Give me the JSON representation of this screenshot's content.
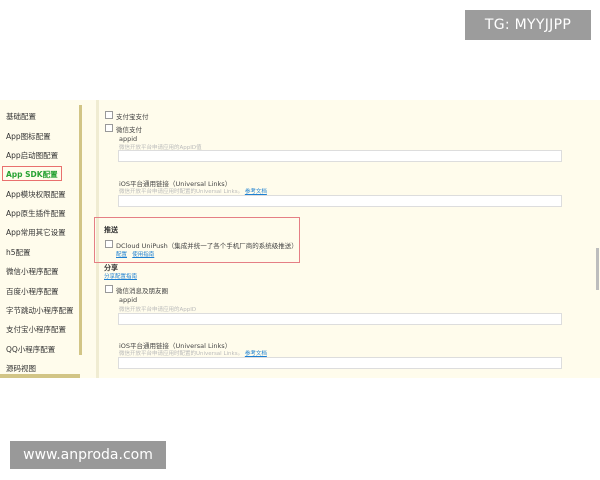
{
  "watermarks": {
    "tg": "TG: MYYJJPP",
    "site": "www.anproda.com"
  },
  "sidebar": {
    "items": [
      {
        "label": "基础配置"
      },
      {
        "label": "App图标配置"
      },
      {
        "label": "App启动图配置"
      },
      {
        "label": "App SDK配置"
      },
      {
        "label": "App模块权限配置"
      },
      {
        "label": "App原生插件配置"
      },
      {
        "label": "App常用其它设置"
      },
      {
        "label": "h5配置"
      },
      {
        "label": "微信小程序配置"
      },
      {
        "label": "百度小程序配置"
      },
      {
        "label": "字节跳动小程序配置"
      },
      {
        "label": "支付宝小程序配置"
      },
      {
        "label": "QQ小程序配置"
      },
      {
        "label": "源码视图"
      }
    ],
    "active_index": 3
  },
  "content": {
    "payment": {
      "alipay_label": "支付宝支付",
      "wechatpay_label": "微信支付",
      "appid_label": "appid",
      "appid_hint": "微信开放平台申请应用的AppID值",
      "ulink_label": "iOS平台通用链接（Universal Links）",
      "ulink_hint": "微信开放平台申请应用时配置的Universal Links。",
      "ulink_doc": "参考文档"
    },
    "push": {
      "title": "推送",
      "unipush_label": "DCloud UniPush（集成并统一了各个手机厂商的系统级推送）",
      "config_link": "配置",
      "guide_link": "使用指南"
    },
    "share": {
      "title": "分享",
      "config_link": "分享配置指南",
      "wechat_label": "微信消息及朋友圈",
      "appid_label": "appid",
      "appid_hint": "微信开放平台申请应用的AppID",
      "ulink_label": "iOS平台通用链接（Universal Links）",
      "ulink_hint": "微信开放平台申请应用时配置的Universal Links。",
      "ulink_doc": "参考文档"
    }
  },
  "colors": {
    "panel_bg": "#fffcec",
    "active_item": "#27a233",
    "highlight_border": "#e57f85",
    "link": "#1e80d2"
  }
}
